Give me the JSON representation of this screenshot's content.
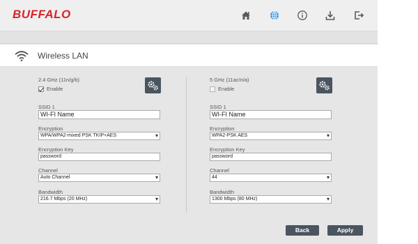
{
  "brand": {
    "logo_text": "BUFFALO",
    "logo_color": "#d9232a"
  },
  "nav": {
    "icons": [
      "home-icon",
      "globe-icon",
      "info-icon",
      "download-icon",
      "logout-icon"
    ],
    "active_color": "#3a8fd6"
  },
  "section": {
    "title": "Wireless LAN",
    "icon": "wifi-icon"
  },
  "band_24": {
    "label": "2.4 GHz (11n/g/b)",
    "enable_label": "Enable",
    "enabled": true,
    "ssid_label": "SSID 1",
    "ssid_value": "WI-FI Name",
    "encryption_label": "Encryption",
    "encryption_value": "WPA/WPA2-mixed PSK TKIP+AES",
    "key_label": "Encryption Key",
    "key_value": "password",
    "channel_label": "Channel",
    "channel_value": "Auto Channel",
    "bandwidth_label": "Bandwidth",
    "bandwidth_value": "216.7 Mbps (20 MHz)"
  },
  "band_5": {
    "label": "5 GHz (11ac/n/a)",
    "enable_label": "Enable",
    "enabled": false,
    "ssid_label": "SSID 1",
    "ssid_value": "WI-FI Name",
    "encryption_label": "Encryption",
    "encryption_value": "WPA2-PSK AES",
    "key_label": "Encryption Key",
    "key_value": "password",
    "channel_label": "Channel",
    "channel_value": "44",
    "bandwidth_label": "Bandwidth",
    "bandwidth_value": "1300 Mbps (80 MHz)"
  },
  "actions": {
    "back_label": "Back",
    "apply_label": "Apply",
    "button_color": "#4a5560"
  }
}
